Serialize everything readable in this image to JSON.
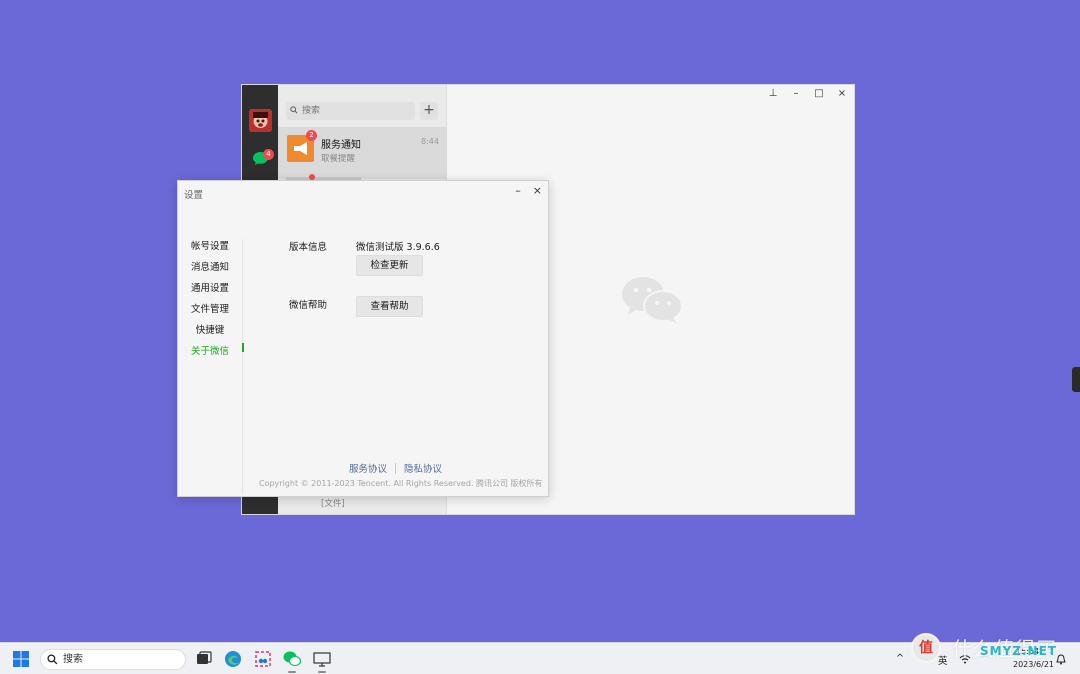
{
  "wechat": {
    "search_placeholder": "搜索",
    "add_glyph": "+",
    "unread_chats": "4",
    "active_chat": {
      "title": "服务通知",
      "subtitle": "取餐提醒",
      "time": "8:44",
      "unread": "2"
    },
    "last_chat_preview": "[文件]",
    "window_controls": {
      "pin": "⊥",
      "minimize": "–",
      "maximize": "□",
      "close": "×"
    }
  },
  "settings": {
    "title": "设置",
    "controls": {
      "minimize": "–",
      "close": "×"
    },
    "nav": [
      {
        "label": "帐号设置"
      },
      {
        "label": "消息通知"
      },
      {
        "label": "通用设置"
      },
      {
        "label": "文件管理"
      },
      {
        "label": "快捷键"
      },
      {
        "label": "关于微信",
        "active": true
      }
    ],
    "version_label": "版本信息",
    "version_value": "微信测试版 3.9.6.6",
    "check_update_button": "检查更新",
    "help_label": "微信帮助",
    "view_help_button": "查看帮助",
    "service_agreement": "服务协议",
    "privacy_agreement": "隐私协议",
    "copyright": "Copyright © 2011-2023 Tencent. All Rights Reserved. 腾讯公司 版权所有"
  },
  "taskbar": {
    "search_label": "搜索",
    "tray_chevron": "^",
    "ime": "英",
    "time": "15:54",
    "date": "2023/6/21"
  },
  "watermark": {
    "badge": "值",
    "text": "什么值得买",
    "sub": "SMYZ.NET"
  },
  "colors": {
    "desktop": "#6b69d7",
    "accent_green": "#1aad19",
    "link_blue": "#576b95",
    "badge_red": "#f04a4a"
  }
}
